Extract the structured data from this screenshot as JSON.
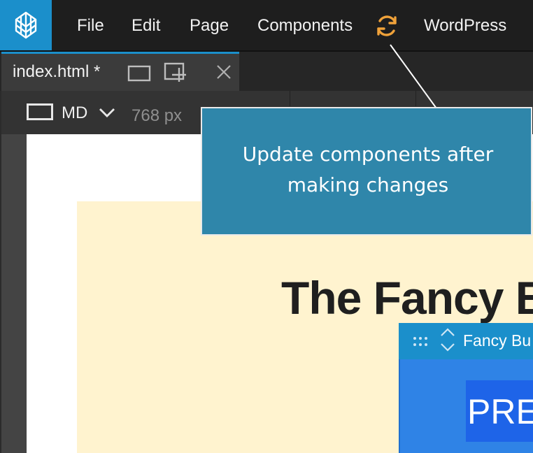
{
  "menubar": {
    "items": [
      "File",
      "Edit",
      "Page",
      "Components",
      "WordPress"
    ],
    "logo_icon": "pinegrow-logo-icon",
    "sync_icon": "refresh-icon",
    "sync_color": "#f0a23a"
  },
  "tab": {
    "label": "index.html *",
    "icons": [
      "single-page-icon",
      "add-page-icon",
      "close-icon"
    ]
  },
  "toolbar": {
    "breakpoint": "MD",
    "width": "768 px",
    "device_icon": "device-frame-icon",
    "chevron_icon": "chevron-down-icon"
  },
  "canvas": {
    "heading": "The Fancy B",
    "component_name": "Fancy Bu",
    "button_text": "PRE"
  },
  "tooltip": {
    "line1": "Update components after",
    "line2": "making changes"
  },
  "colors": {
    "accent": "#1b8fcb",
    "tooltip_bg": "#2f86aa",
    "section_bg": "#fff3cf",
    "button_bg": "#1e64e8"
  }
}
